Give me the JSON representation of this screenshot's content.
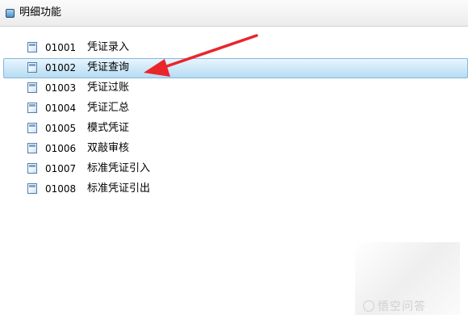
{
  "header": {
    "title": "明细功能",
    "icon": "panel-icon"
  },
  "menu": {
    "items": [
      {
        "code": "01001",
        "label": "凭证录入",
        "icon": "document-icon",
        "selected": false
      },
      {
        "code": "01002",
        "label": "凭证查询",
        "icon": "document-icon",
        "selected": true
      },
      {
        "code": "01003",
        "label": "凭证过账",
        "icon": "document-icon",
        "selected": false
      },
      {
        "code": "01004",
        "label": "凭证汇总",
        "icon": "document-icon",
        "selected": false
      },
      {
        "code": "01005",
        "label": "模式凭证",
        "icon": "document-icon",
        "selected": false
      },
      {
        "code": "01006",
        "label": "双敲审核",
        "icon": "document-icon",
        "selected": false
      },
      {
        "code": "01007",
        "label": "标准凭证引入",
        "icon": "document-icon",
        "selected": false
      },
      {
        "code": "01008",
        "label": "标准凭证引出",
        "icon": "document-icon",
        "selected": false
      }
    ]
  },
  "annotation": {
    "arrow_color": "#e8262b",
    "points_to": "01002"
  },
  "watermark": {
    "text": "悟空问答"
  },
  "colors": {
    "selection_fill": "#c4e3f6",
    "selection_border": "#84b8de",
    "header_bg": "#f2f2f2"
  }
}
